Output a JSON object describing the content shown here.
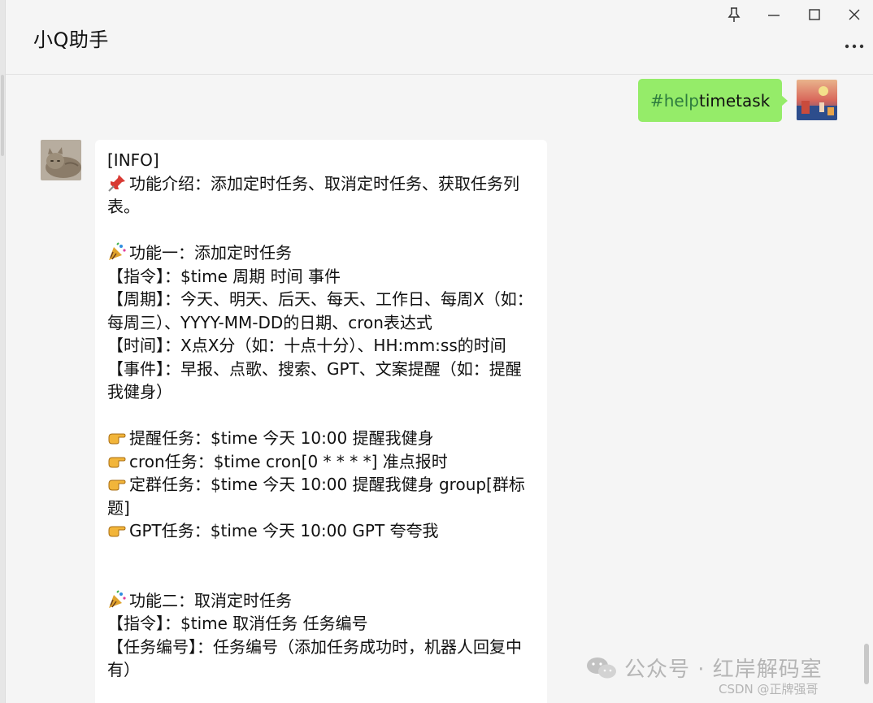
{
  "window": {
    "title": "小Q助手",
    "controls": [
      "pin-icon",
      "minimize-icon",
      "maximize-icon",
      "close-icon",
      "more-icon"
    ]
  },
  "user_message": {
    "tag": "#help",
    "text": " timetask",
    "bubble_color": "#95ec69"
  },
  "bot_message": {
    "bubble_color": "#ffffff",
    "lines": {
      "l1": "[INFO]",
      "l2": "功能介绍：添加定时任务、取消定时任务、获取任务列表。",
      "l3": "功能一：添加定时任务",
      "l4": "【指令】：$time 周期 时间 事件",
      "l5": "【周期】：今天、明天、后天、每天、工作日、每周X（如：每周三）、YYYY-MM-DD的日期、cron表达式",
      "l6": "【时间】：X点X分（如：十点十分）、HH:mm:ss的时间",
      "l7": "【事件】：早报、点歌、搜索、GPT、文案提醒（如：提醒我健身）",
      "l8": "提醒任务：$time 今天 10:00 提醒我健身",
      "l9": "cron任务：$time cron[0 * * * *] 准点报时",
      "l10": "定群任务：$time 今天 10:00 提醒我健身 group[群标题]",
      "l11": "GPT任务：$time 今天 10:00 GPT 夸夸我",
      "l12": "功能二：取消定时任务",
      "l13": "【指令】：$time 取消任务 任务编号",
      "l14": "【任务编号】：任务编号（添加任务成功时，机器人回复中有）"
    }
  },
  "watermark": {
    "text": "公众号 · 红岸解码室",
    "source": "CSDN @正牌强哥"
  }
}
